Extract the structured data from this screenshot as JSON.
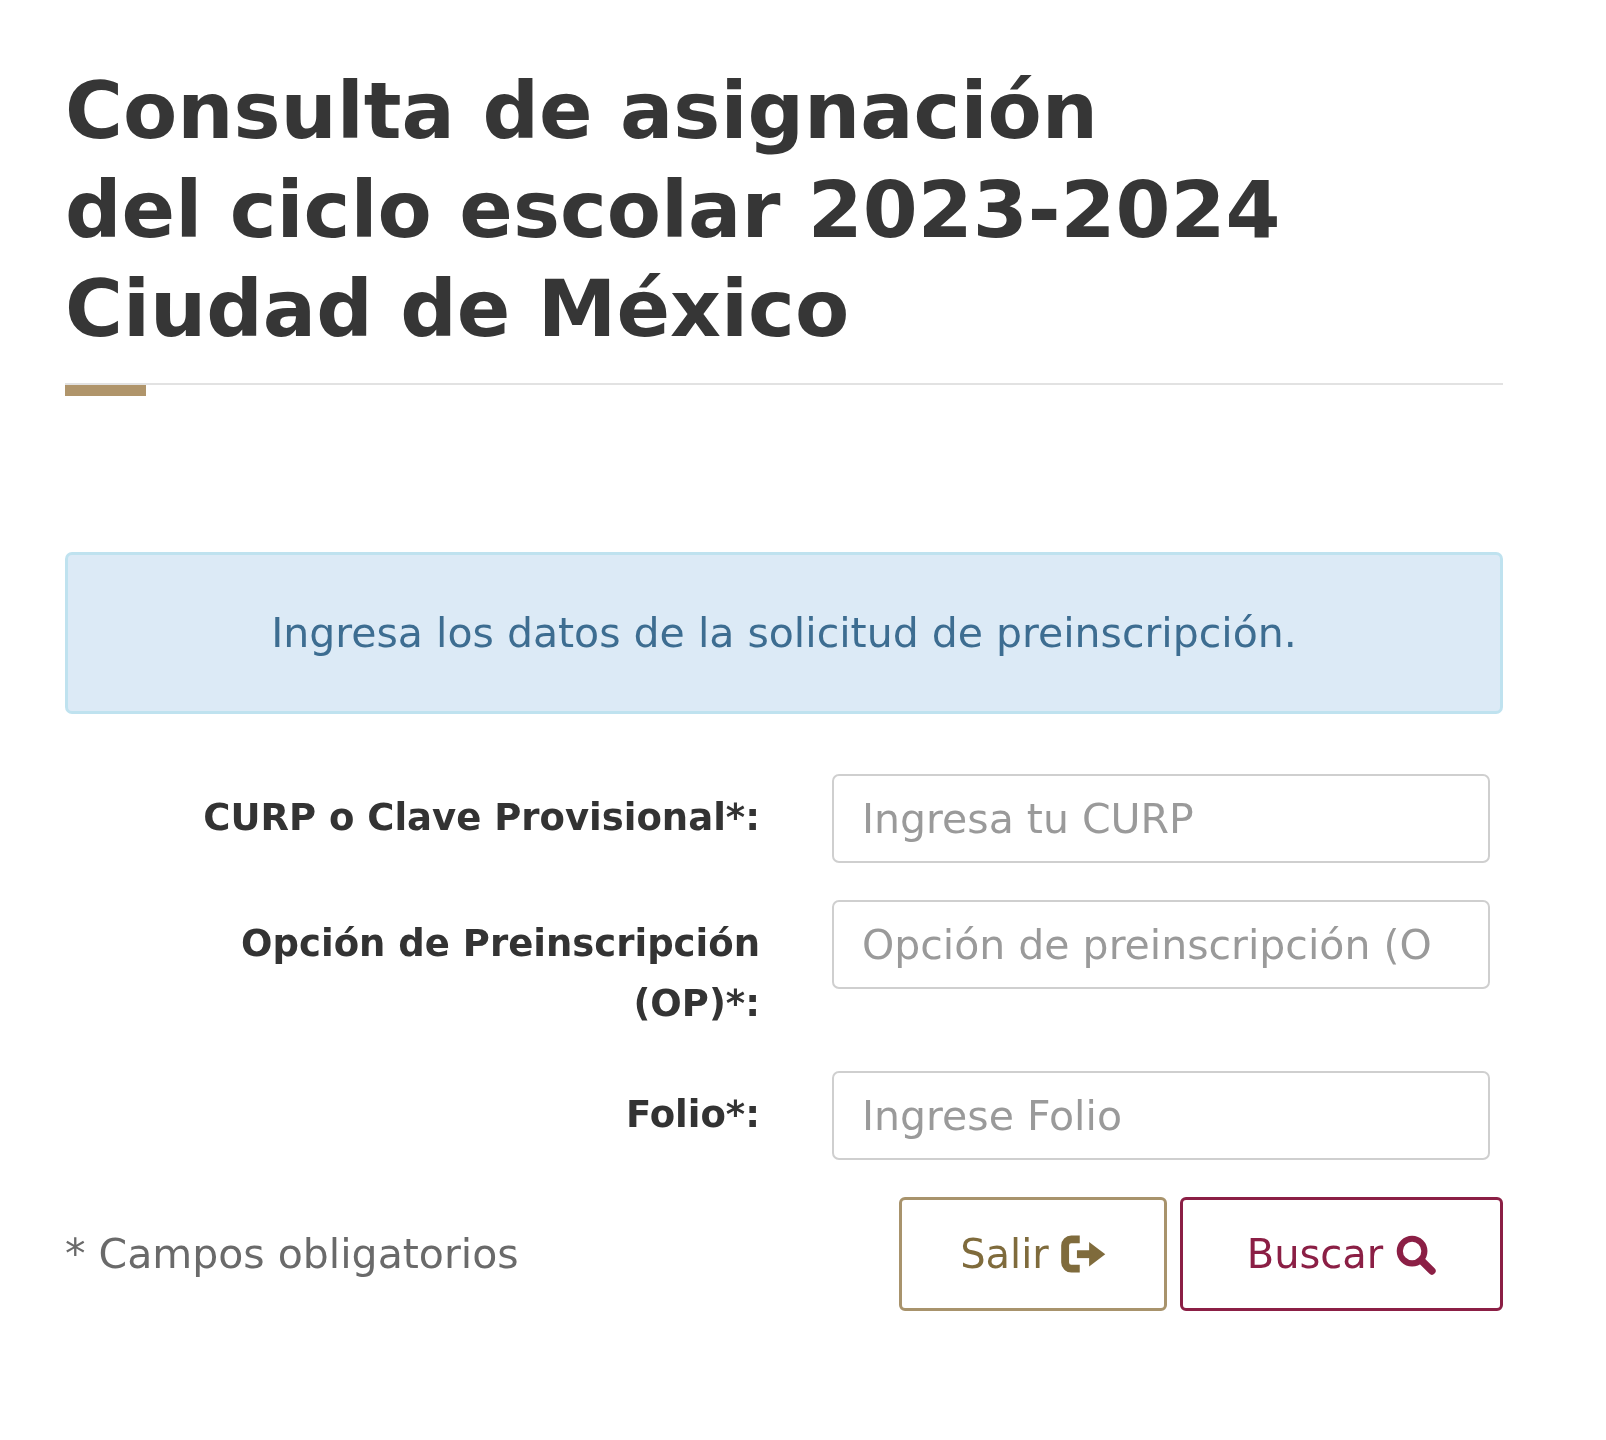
{
  "header": {
    "title_lines": [
      "Consulta de asignación",
      "del ciclo escolar 2023-2024",
      "Ciudad de México"
    ]
  },
  "alert": {
    "kind": "info",
    "text": "Ingresa los datos de la solicitud de preinscripción."
  },
  "form": {
    "fields": [
      {
        "label": "CURP o Clave Provisional*:",
        "placeholder": "Ingresa tu CURP"
      },
      {
        "label": "Opción de Preinscripción (OP)*:",
        "placeholder": "Opción de preinscripción (O"
      },
      {
        "label": "Folio*:",
        "placeholder": "Ingrese Folio"
      }
    ]
  },
  "footer": {
    "note": "* Campos obligatorios",
    "buttons": [
      {
        "label": "Salir",
        "kind": "exit"
      },
      {
        "label": "Buscar",
        "kind": "search"
      }
    ]
  }
}
